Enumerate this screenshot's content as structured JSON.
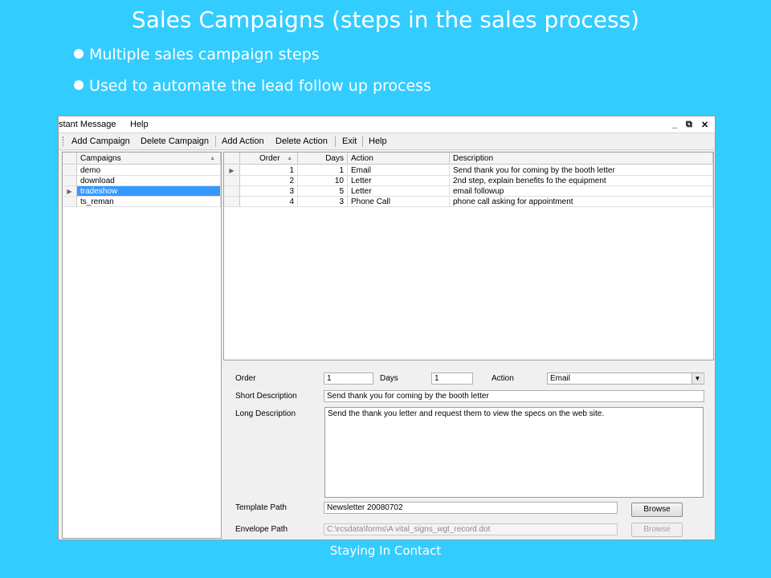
{
  "slide": {
    "title": "Sales Campaigns (steps in the sales process)",
    "bullets": [
      "Multiple sales campaign steps",
      "Used to automate the lead follow up process"
    ],
    "footer": "Staying In Contact"
  },
  "window": {
    "menu": [
      "stant Message",
      "Help"
    ],
    "controls": [
      "_",
      "⧉",
      "✕"
    ],
    "toolbar": [
      "Add Campaign",
      "Delete Campaign",
      "Add Action",
      "Delete Action",
      "Exit",
      "Help"
    ]
  },
  "campaigns": {
    "header": "Campaigns",
    "sort_icon": "▲",
    "items": [
      "demo",
      "download",
      "tradeshow",
      "ts_reman"
    ],
    "selected_index": 2
  },
  "actions_grid": {
    "headers": {
      "order": "Order",
      "days": "Days",
      "action": "Action",
      "description": "Description"
    },
    "sort_icon": "▲",
    "rows": [
      {
        "order": "1",
        "days": "1",
        "action": "Email",
        "description": "Send thank you for coming by the booth letter"
      },
      {
        "order": "2",
        "days": "10",
        "action": "Letter",
        "description": "2nd step, explain benefits fo the equipment"
      },
      {
        "order": "3",
        "days": "5",
        "action": "Letter",
        "description": "email followup"
      },
      {
        "order": "4",
        "days": "3",
        "action": "Phone Call",
        "description": "phone call asking for appointment"
      }
    ]
  },
  "detail": {
    "order_label": "Order",
    "order_value": "1",
    "days_label": "Days",
    "days_value": "1",
    "action_label": "Action",
    "action_value": "Email",
    "short_desc_label": "Short Description",
    "short_desc_value": "Send thank you for coming by the booth letter",
    "long_desc_label": "Long Description",
    "long_desc_value": "Send the thank you letter and request them to view the specs on the web site.",
    "template_label": "Template Path",
    "template_value": "Newsletter 20080702",
    "envelope_label": "Envelope Path",
    "envelope_value": "C:\\rcsdata\\forms\\A vital_signs_wgt_record.dot",
    "browse_label": "Browse"
  }
}
